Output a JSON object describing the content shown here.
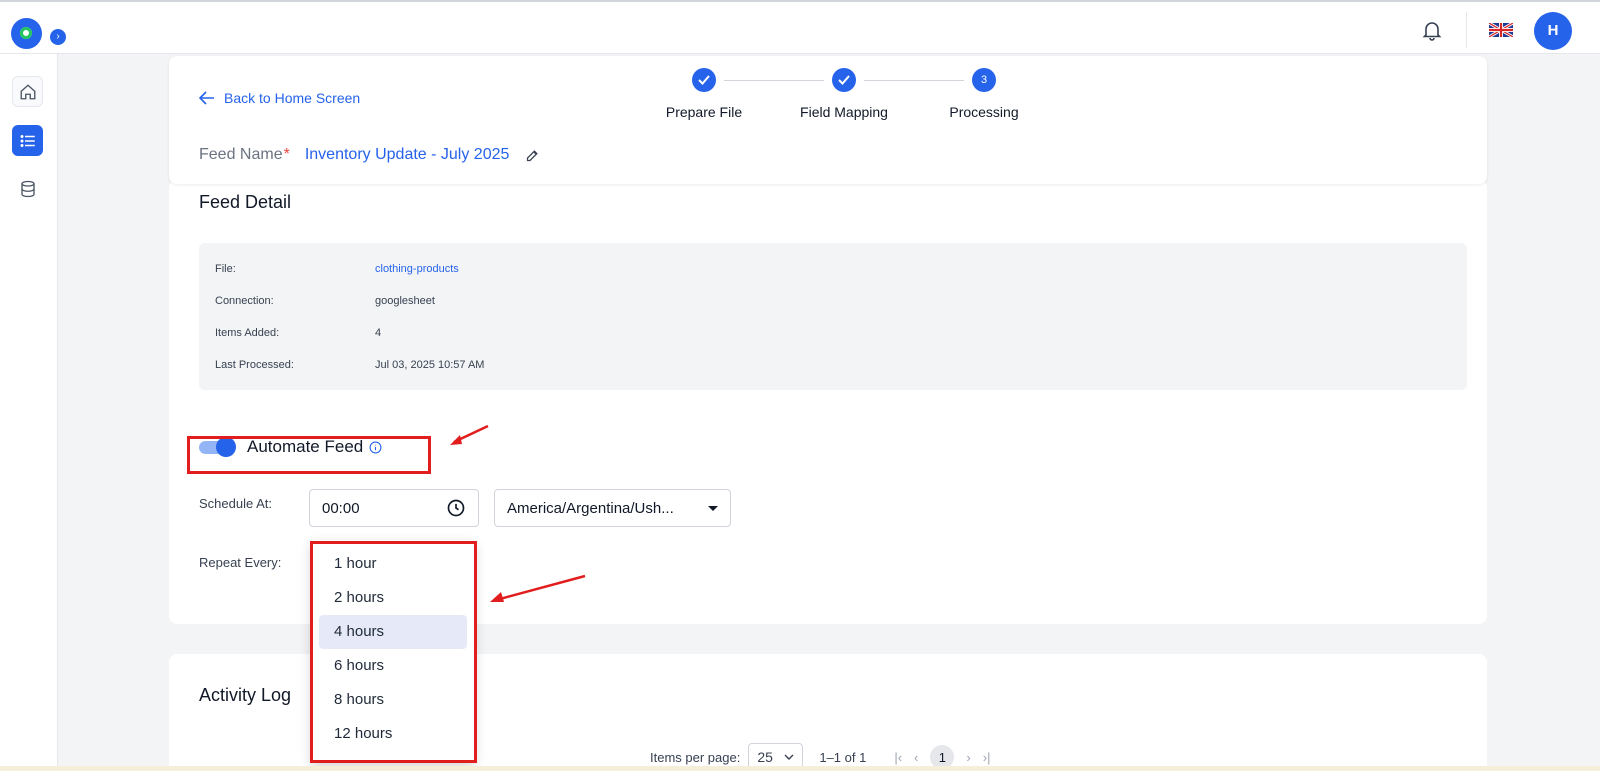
{
  "topbar": {
    "avatar_initial": "H",
    "icons": [
      "notification-bell-icon",
      "uk-flag-icon"
    ]
  },
  "sidebar": {
    "items": [
      {
        "icon": "home-icon"
      },
      {
        "icon": "list-icon",
        "active": true
      },
      {
        "icon": "database-icon"
      }
    ]
  },
  "header": {
    "back_label": "Back to Home Screen",
    "steps": [
      {
        "number": "1",
        "label": "Prepare File",
        "done": true
      },
      {
        "number": "2",
        "label": "Field Mapping",
        "done": true
      },
      {
        "number": "3",
        "label": "Processing",
        "done": false
      }
    ],
    "feed_name_label": "Feed Name",
    "required_mark": "*",
    "feed_name_value": "Inventory Update - July 2025"
  },
  "feed_detail": {
    "title": "Feed Detail",
    "rows": [
      {
        "key": "File:",
        "value": "clothing-products"
      },
      {
        "key": "Connection:",
        "value": "googlesheet"
      },
      {
        "key": "Items Added:",
        "value": "4"
      },
      {
        "key": "Last Processed:",
        "value": "Jul 03, 2025 10:57 AM"
      }
    ],
    "automate_label": "Automate Feed",
    "automate_enabled": true,
    "schedule_label": "Schedule At:",
    "schedule_time": "00:00",
    "timezone": "America/Argentina/Ush...",
    "repeat_label": "Repeat Every:",
    "repeat_options": [
      "1 hour",
      "2 hours",
      "4 hours",
      "6 hours",
      "8 hours",
      "12 hours"
    ],
    "repeat_highlighted": "4 hours"
  },
  "activity_log": {
    "title": "Activity Log",
    "items_per_page_label": "Items per page:",
    "items_per_page": "25",
    "range": "1–1 of 1",
    "current_page": "1"
  },
  "colors": {
    "accent": "#2563eb",
    "annotation": "#e11d1d",
    "highlight": "#e6eaf8"
  }
}
